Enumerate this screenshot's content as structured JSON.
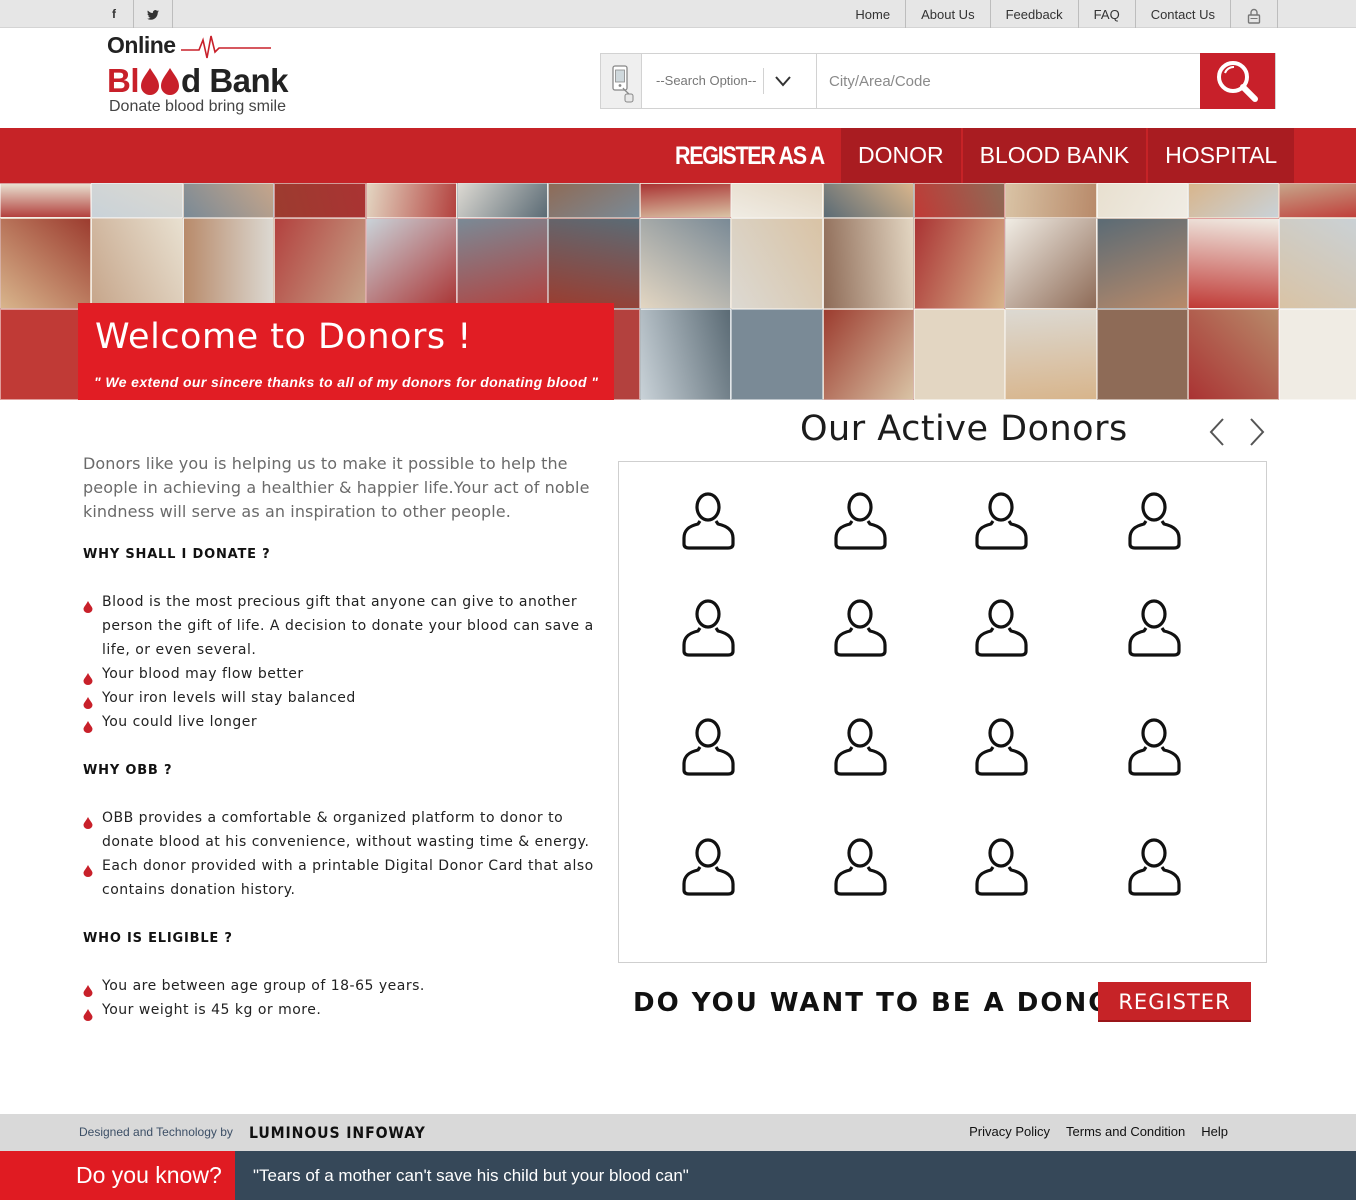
{
  "social": {
    "facebook_label": "f",
    "twitter_icon": "twitter-icon"
  },
  "topnav": [
    "Home",
    "About Us",
    "Feedback",
    "FAQ",
    "Contact Us"
  ],
  "logo": {
    "line1": "Online",
    "line2_a": "Bl",
    "line2_b": "d Bank",
    "tagline": "Donate blood bring smile"
  },
  "search": {
    "option_label": "--Search Option--",
    "placeholder": "City/Area/Code"
  },
  "register": {
    "label": "REGISTER AS A",
    "tabs": [
      "DONOR",
      "BLOOD BANK",
      "HOSPITAL"
    ]
  },
  "banner": {
    "title": "Welcome to Donors !",
    "subtitle": "\" We extend our sincere thanks to all of my donors for donating blood \""
  },
  "intro": "Donors like you is helping us to make it possible to help the people in achieving a healthier & happier life.Your act of noble kindness will serve as an inspiration to other people.",
  "sections": [
    {
      "heading": "WHY SHALL I DONATE ?",
      "items": [
        "Blood is the most precious gift that anyone can give to another person the gift of life. A decision to donate your blood can save a life, or even several.",
        "Your blood may flow better",
        "Your iron levels will stay balanced",
        "You could live longer"
      ]
    },
    {
      "heading": "WHY OBB ?",
      "items": [
        "OBB provides a comfortable & organized platform to donor to donate blood at his convenience, without wasting time & energy.",
        "Each donor provided with a printable Digital Donor Card that also contains donation history."
      ]
    },
    {
      "heading": "WHO IS ELIGIBLE ?",
      "items": [
        "You are between age group of 18-65 years.",
        "Your weight is 45 kg or more."
      ]
    }
  ],
  "donors": {
    "title": "Our Active Donors",
    "count": 16
  },
  "cta": {
    "question": "DO YOU WANT TO BE A DONOR ?",
    "button": "REGISTER"
  },
  "footer": {
    "credit": "Designed and Technology by",
    "company": "LUMINOUS INFOWAY",
    "links": [
      "Privacy Policy",
      "Terms and Condition",
      "Help"
    ],
    "dyk": "Do you know?",
    "quote": "\"Tears of a mother can't save his child but your blood can\""
  },
  "colors": {
    "brand_red": "#c62327",
    "dark_red": "#a91c21",
    "footer_dark": "#364859"
  }
}
